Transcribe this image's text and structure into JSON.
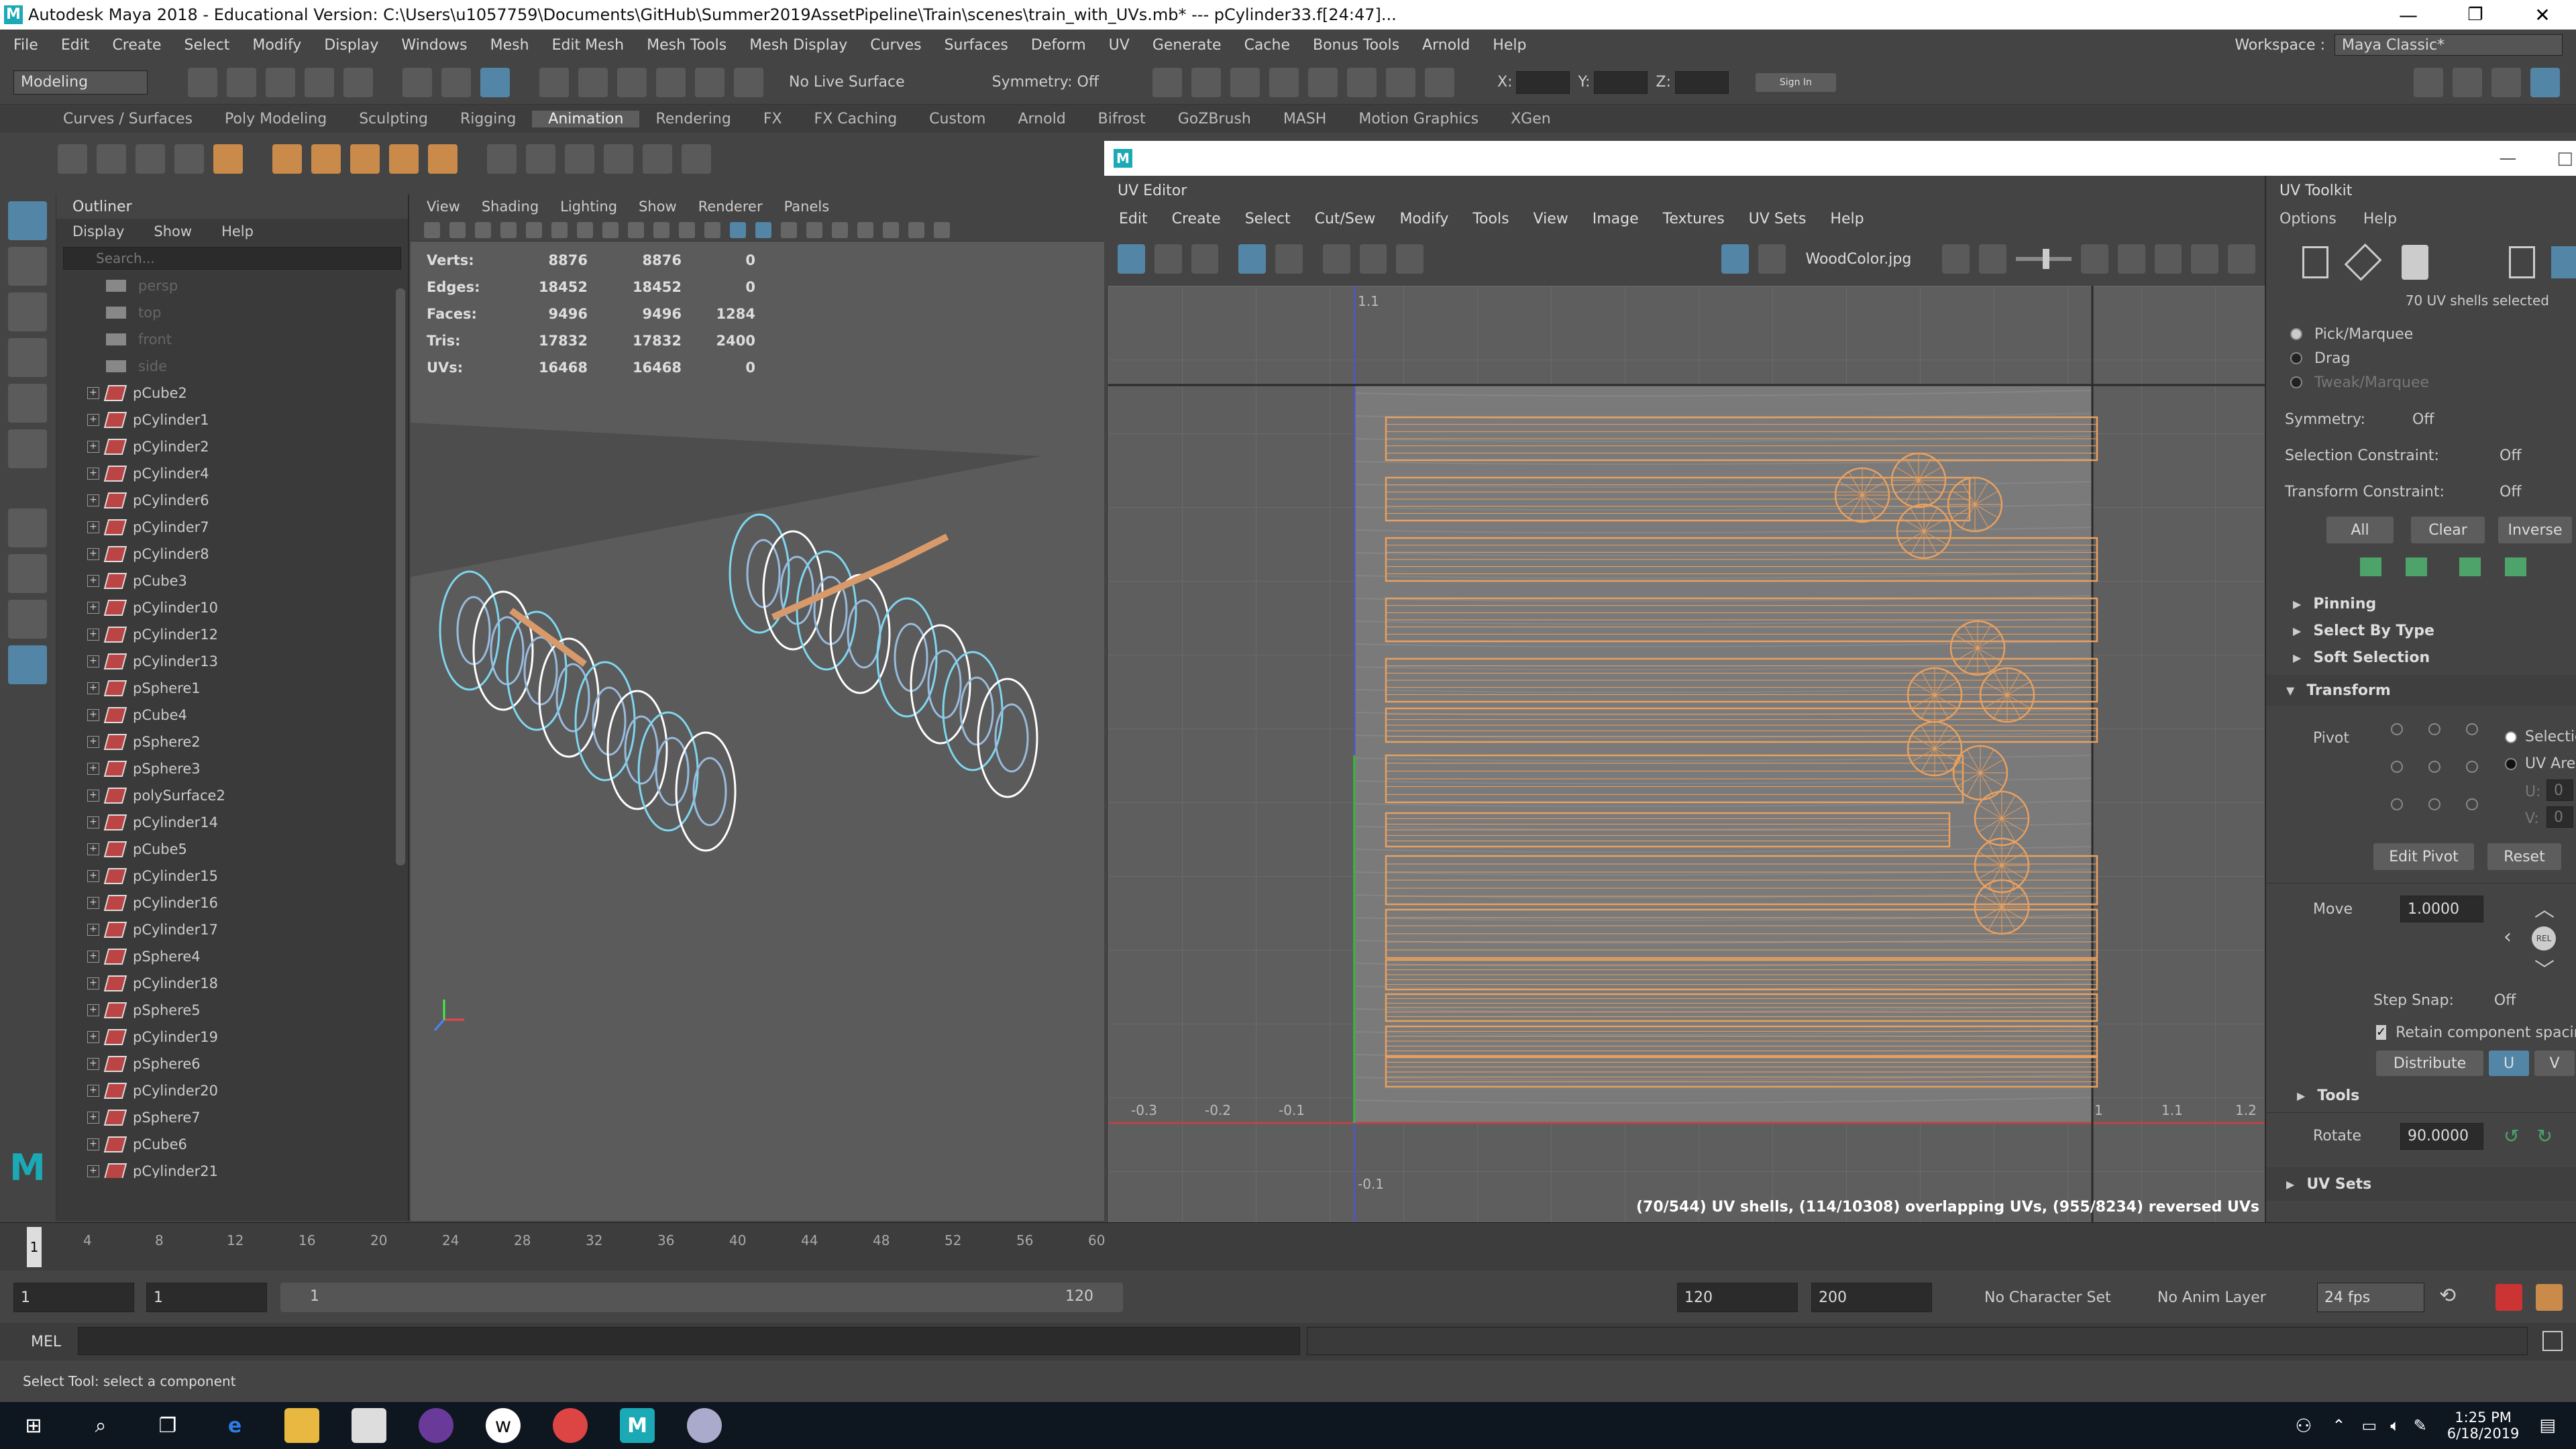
{
  "app": {
    "title": "Autodesk Maya 2018 - Educational Version: C:\\Users\\u1057759\\Documents\\GitHub\\Summer2019AssetPipeline\\Train\\scenes\\train_with_UVs.mb*  ---  pCylinder33.f[24:47]..."
  },
  "menubar": {
    "items": [
      "File",
      "Edit",
      "Create",
      "Select",
      "Modify",
      "Display",
      "Windows",
      "Mesh",
      "Edit Mesh",
      "Mesh Tools",
      "Mesh Display",
      "Curves",
      "Surfaces",
      "Deform",
      "UV",
      "Generate",
      "Cache",
      "Bonus Tools",
      "Arnold",
      "Help"
    ],
    "workspace_label": "Workspace :",
    "workspace_value": "Maya Classic*"
  },
  "statusline": {
    "mode": "Modeling",
    "live_surface": "No Live Surface",
    "symmetry": "Symmetry: Off",
    "x_label": "X:",
    "y_label": "Y:",
    "z_label": "Z:",
    "sign_in": "Sign In"
  },
  "shelf": {
    "tabs": [
      "Curves / Surfaces",
      "Poly Modeling",
      "Sculpting",
      "Rigging",
      "Animation",
      "Rendering",
      "FX",
      "FX Caching",
      "Custom",
      "Arnold",
      "Bifrost",
      "GoZBrush",
      "MASH",
      "Motion Graphics",
      "XGen"
    ],
    "active_tab": "Animation"
  },
  "outliner": {
    "title": "Outliner",
    "menu": [
      "Display",
      "Show",
      "Help"
    ],
    "search_placeholder": "Search...",
    "cameras": [
      "persp",
      "top",
      "front",
      "side"
    ],
    "items": [
      "pCube2",
      "pCylinder1",
      "pCylinder2",
      "pCylinder4",
      "pCylinder6",
      "pCylinder7",
      "pCylinder8",
      "pCube3",
      "pCylinder10",
      "pCylinder12",
      "pCylinder13",
      "pSphere1",
      "pCube4",
      "pSphere2",
      "pSphere3",
      "polySurface2",
      "pCylinder14",
      "pCube5",
      "pCylinder15",
      "pCylinder16",
      "pCylinder17",
      "pSphere4",
      "pCylinder18",
      "pSphere5",
      "pCylinder19",
      "pSphere6",
      "pCylinder20",
      "pSphere7",
      "pCube6",
      "pCylinder21"
    ]
  },
  "viewport": {
    "menu": [
      "View",
      "Shading",
      "Lighting",
      "Show",
      "Renderer",
      "Panels"
    ],
    "hud": [
      {
        "label": "Verts:",
        "a": "8876",
        "b": "8876",
        "c": "0"
      },
      {
        "label": "Edges:",
        "a": "18452",
        "b": "18452",
        "c": "0"
      },
      {
        "label": "Faces:",
        "a": "9496",
        "b": "9496",
        "c": "1284"
      },
      {
        "label": "Tris:",
        "a": "17832",
        "b": "17832",
        "c": "2400"
      },
      {
        "label": "UVs:",
        "a": "16468",
        "b": "16468",
        "c": "0"
      }
    ]
  },
  "uv_editor": {
    "title": "UV Editor",
    "menu": [
      "Edit",
      "Create",
      "Select",
      "Cut/Sew",
      "Modify",
      "Tools",
      "View",
      "Image",
      "Textures",
      "UV Sets",
      "Help"
    ],
    "texture": "WoodColor.jpg",
    "axis_labels": [
      "-0.3",
      "-0.2",
      "-0.1",
      "1",
      "1.1",
      "1.2"
    ],
    "v_labels": [
      "1.1",
      "-0.1"
    ],
    "footer": "(70/544) UV shells, (114/10308) overlapping UVs, (955/8234) reversed UVs"
  },
  "uv_toolkit": {
    "title": "UV Toolkit",
    "menu": [
      "Options",
      "Help"
    ],
    "shells_selected": "70 UV shells selected",
    "modes": [
      "Pick/Marquee",
      "Drag",
      "Tweak/Marquee"
    ],
    "symmetry_label": "Symmetry:",
    "symmetry_value": "Off",
    "selection_constraint_label": "Selection Constraint:",
    "selection_constraint_value": "Off",
    "transform_constraint_label": "Transform Constraint:",
    "transform_constraint_value": "Off",
    "buttons": [
      "All",
      "Clear",
      "Inverse"
    ],
    "sections": [
      "Pinning",
      "Select By Type",
      "Soft Selection"
    ],
    "transform_section": "Transform",
    "pivot_label": "Pivot",
    "pivot_opt1": "Selection",
    "pivot_opt2": "UV Area",
    "u_label": "U:",
    "v_label": "V:",
    "u_value": "0",
    "v_value": "0",
    "edit_pivot": "Edit Pivot",
    "reset": "Reset",
    "move_label": "Move",
    "move_value": "1.0000",
    "rel_label": "REL",
    "step_snap_label": "Step Snap:",
    "step_snap_value": "Off",
    "retain_label": "Retain component spacing",
    "distribute_label": "Distribute",
    "u_btn": "U",
    "v_btn": "V",
    "tools_section": "Tools",
    "rotate_label": "Rotate",
    "rotate_value": "90.0000",
    "uv_sets_section": "UV Sets"
  },
  "timeline": {
    "ticks": [
      "4",
      "8",
      "12",
      "16",
      "20",
      "24",
      "28",
      "32",
      "36",
      "40",
      "44",
      "48",
      "52",
      "56",
      "60"
    ],
    "current_frame": "1"
  },
  "range": {
    "start": "1",
    "start2": "1",
    "range_start": "1",
    "range_end": "120",
    "end": "120",
    "end2": "200",
    "char_set": "No Character Set",
    "anim_layer": "No Anim Layer",
    "fps": "24 fps"
  },
  "mel": {
    "label": "MEL"
  },
  "helpline": {
    "text": "Select Tool: select a component"
  },
  "taskbar": {
    "time": "1:25 PM",
    "date": "6/18/2019"
  },
  "colors": {
    "accent_blue": "#5285a6",
    "uv_orange": "#e8a060",
    "maya_teal": "#1aa9b5"
  }
}
